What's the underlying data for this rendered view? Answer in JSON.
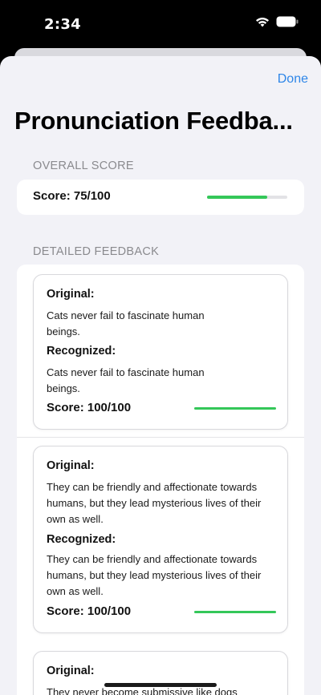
{
  "status_bar": {
    "time": "2:34"
  },
  "nav": {
    "done_label": "Done",
    "title": "Pronunciation Feedba..."
  },
  "overall": {
    "header": "OVERALL SCORE",
    "score_label": "Score: 75/100",
    "score_fraction": 0.75
  },
  "detailed": {
    "header": "DETAILED FEEDBACK",
    "original_label": "Original:",
    "recognized_label": "Recognized:",
    "items": [
      {
        "original": "Cats never fail to fascinate human beings.",
        "recognized": "Cats never fail to fascinate human beings.",
        "score_label": "Score: 100/100",
        "score_fraction": 1.0
      },
      {
        "original": "They can be friendly and affectionate towards humans, but they lead mysterious lives of their own as well.",
        "recognized": "They can be friendly and affectionate towards humans, but they lead mysterious lives of their own as well.",
        "score_label": "Score: 100/100",
        "score_fraction": 1.0
      },
      {
        "original": "They never become submissive like dogs",
        "recognized": "",
        "score_label": "",
        "score_fraction": null
      }
    ]
  },
  "colors": {
    "accent": "#2e86e8",
    "progress": "#34c759",
    "background": "#f2f2f7"
  }
}
